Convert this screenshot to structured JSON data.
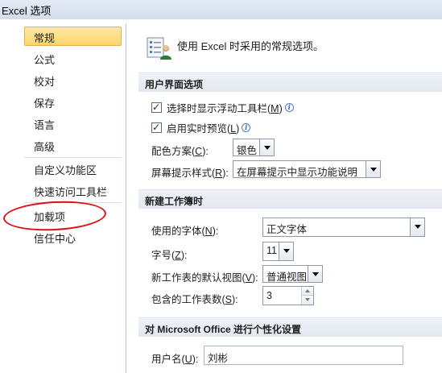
{
  "window": {
    "title": "Excel 选项"
  },
  "sidebar": {
    "items": [
      {
        "label": "常规",
        "active": true
      },
      {
        "label": "公式"
      },
      {
        "label": "校对"
      },
      {
        "label": "保存"
      },
      {
        "label": "语言"
      },
      {
        "label": "高级"
      },
      {
        "label": "自定义功能区"
      },
      {
        "label": "快速访问工具栏"
      },
      {
        "label": "加载项"
      },
      {
        "label": "信任中心"
      }
    ]
  },
  "header": {
    "text": "使用 Excel 时采用的常规选项。"
  },
  "sections": {
    "ui": "用户界面选项",
    "new_workbook": "新建工作簿时",
    "personalize": "对 Microsoft Office 进行个性化设置"
  },
  "ui_options": {
    "mini_toolbar": {
      "label": "选择时显示浮动工具栏(",
      "key": "M",
      "suffix": ")",
      "checked": "✓"
    },
    "live_preview": {
      "label": "启用实时预览(",
      "key": "L",
      "suffix": ")",
      "checked": "✓"
    },
    "color_scheme": {
      "label": "配色方案(",
      "key": "C",
      "suffix": "):",
      "value": "银色"
    },
    "screentip": {
      "label": "屏幕提示样式(",
      "key": "R",
      "suffix": "):",
      "value": "在屏幕提示中显示功能说明"
    }
  },
  "new_workbook": {
    "font": {
      "label": "使用的字体(",
      "key": "N",
      "suffix": "):",
      "value": "正文字体"
    },
    "size": {
      "label": "字号(",
      "key": "Z",
      "suffix": "):",
      "value": "11"
    },
    "view": {
      "label": "新工作表的默认视图(",
      "key": "V",
      "suffix": "):",
      "value": "普通视图"
    },
    "sheets": {
      "label": "包含的工作表数(",
      "key": "S",
      "suffix": "):",
      "value": "3"
    }
  },
  "personalize": {
    "username": {
      "label": "用户名(",
      "key": "U",
      "suffix": "):",
      "value": "刘彬"
    }
  },
  "colors": {
    "annotation": "#e00d16",
    "active_nav": "#fbd56c"
  }
}
